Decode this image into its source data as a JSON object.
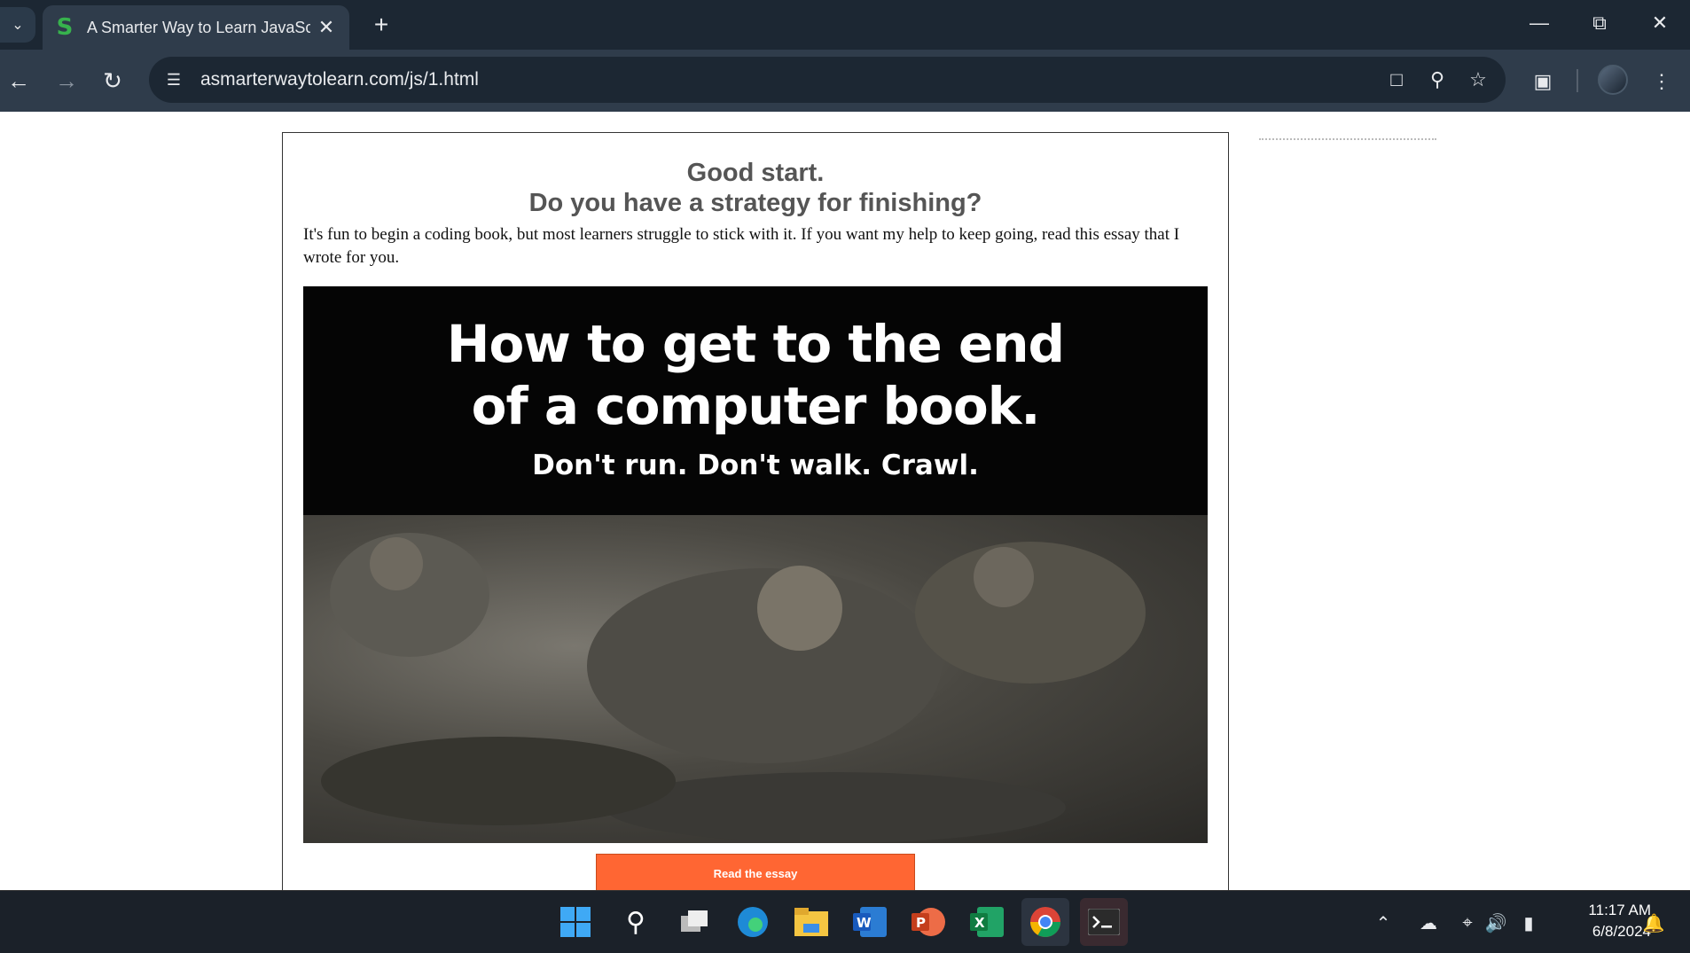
{
  "browser": {
    "tab_title": "A Smarter Way to Learn JavaScr",
    "tab_favicon": "S",
    "url": "asmarterwaytolearn.com/js/1.html"
  },
  "page": {
    "heading_line1": "Good start.",
    "heading_line2": "Do you have a strategy for finishing?",
    "intro": "It's fun to begin a coding book, but most learners struggle to stick with it. If you want my help to keep going, read this essay that I wrote for you.",
    "promo_line1": "How to get to the end",
    "promo_line2": "of a computer book.",
    "promo_line3": "Don't run. Don't walk. Crawl.",
    "button_label": "Read the essay"
  },
  "taskbar": {
    "time": "11:17 AM",
    "date": "6/8/2024"
  },
  "colors": {
    "button": "#ff6633",
    "heading": "#555555",
    "chrome_dark": "#1c2733"
  }
}
